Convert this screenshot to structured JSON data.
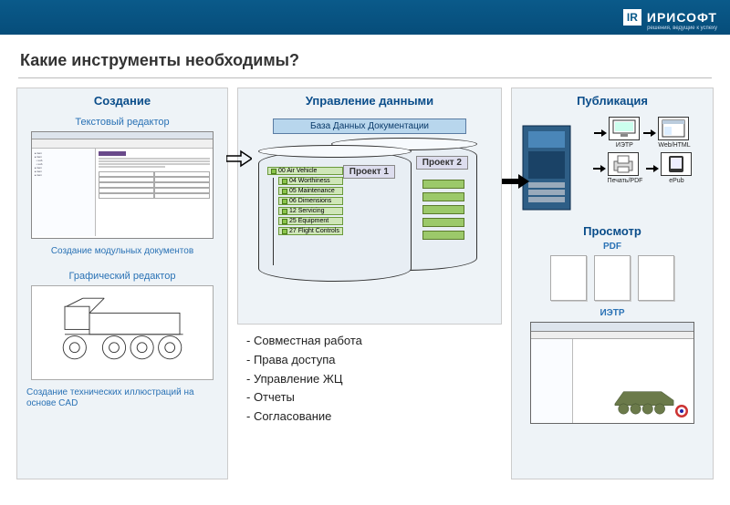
{
  "brand": {
    "badge": "IR",
    "name": "ИРИСОФТ",
    "tagline": "решения, ведущие к успеху"
  },
  "title": "Какие инструменты необходимы?",
  "col1": {
    "title": "Создание",
    "text_editor_label": "Текстовый редактор",
    "caption1": "Создание модульных документов",
    "graphic_editor_label": "Графический редактор",
    "caption2": "Создание технических иллюстраций на основе CAD"
  },
  "col2": {
    "title": "Управление данными",
    "db_title": "База Данных Документации",
    "project1": "Проект 1",
    "project2": "Проект 2",
    "nodes": [
      "00 Air Vehicle",
      "04 Worthiness",
      "05 Maintenance",
      "06 Dimensions",
      "12 Servicing",
      "25 Equipment",
      "27 Flight Controls"
    ],
    "bullets": [
      "- Совместная работа",
      "- Права доступа",
      " - Управление ЖЦ",
      "- Отчеты",
      "- Согласование"
    ]
  },
  "col3": {
    "title": "Публикация",
    "outputs": [
      {
        "label": "ИЭТР"
      },
      {
        "label": "Web/HTML"
      },
      {
        "label": "Печать/PDF"
      },
      {
        "label": "ePub"
      }
    ],
    "viewer_title": "Просмотр",
    "pdf_label": "PDF",
    "ietp_label": "ИЭТР"
  }
}
